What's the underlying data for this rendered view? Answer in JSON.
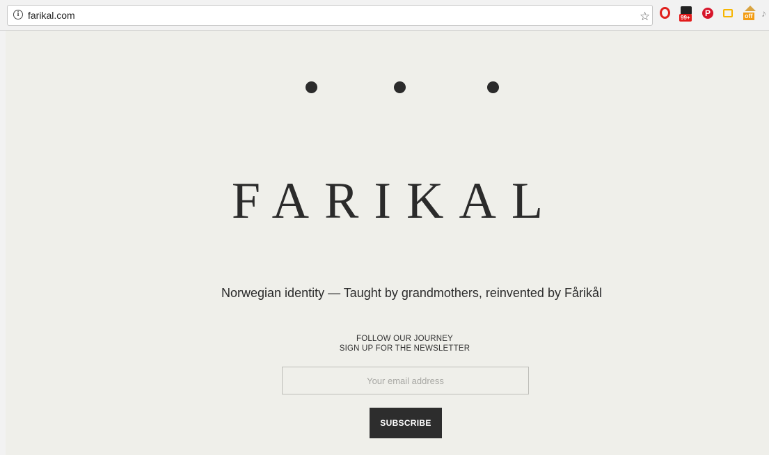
{
  "browser": {
    "url": "farikal.com",
    "info_icon": "ⓘ",
    "bookmark_icon": "☆",
    "extensions": {
      "rss_badge": "99+",
      "pinterest_glyph": "℗",
      "off_badge": "off"
    }
  },
  "page": {
    "logo": "FARIKAL",
    "tagline": "Norwegian identity — Taught by grandmothers, reinvented by Fårikål",
    "cta_line1": "FOLLOW OUR JOURNEY",
    "cta_line2": "SIGN UP FOR THE NEWSLETTER",
    "email_placeholder": "Your email address",
    "subscribe_label": "SUBSCRIBE"
  },
  "colors": {
    "page_background": "#efefea",
    "ink": "#2b2b2b",
    "button": "#2d2d2d"
  }
}
